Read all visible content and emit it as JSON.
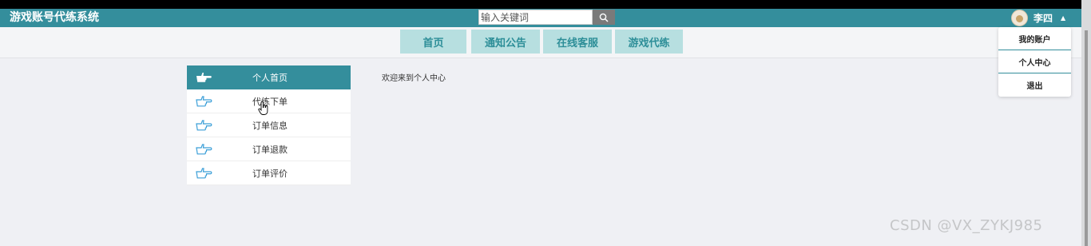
{
  "header": {
    "logo": "游戏账号代练系统",
    "search": {
      "placeholder": "输入关键词",
      "value": ""
    },
    "search_icon": "search-icon",
    "user": {
      "name": "李四",
      "caret_icon": "caret-up-icon"
    }
  },
  "nav": {
    "items": [
      {
        "label": "首页"
      },
      {
        "label": "通知公告"
      },
      {
        "label": "在线客服"
      },
      {
        "label": "游戏代练"
      }
    ]
  },
  "dropdown": {
    "items": [
      {
        "label": "我的账户"
      },
      {
        "label": "个人中心"
      },
      {
        "label": "退出"
      }
    ]
  },
  "sidebar": {
    "icon": "pointing-hand-icon",
    "items": [
      {
        "label": "个人首页",
        "active": true
      },
      {
        "label": "代练下单",
        "active": false
      },
      {
        "label": "订单信息",
        "active": false
      },
      {
        "label": "订单退款",
        "active": false
      },
      {
        "label": "订单评价",
        "active": false
      }
    ]
  },
  "main": {
    "welcome": "欢迎来到个人中心"
  },
  "watermark": "CSDN @VX_ZYKJ985",
  "colors": {
    "primary": "#348e9c",
    "nav_button": "#b7dfe0",
    "background": "#eff0f4"
  }
}
